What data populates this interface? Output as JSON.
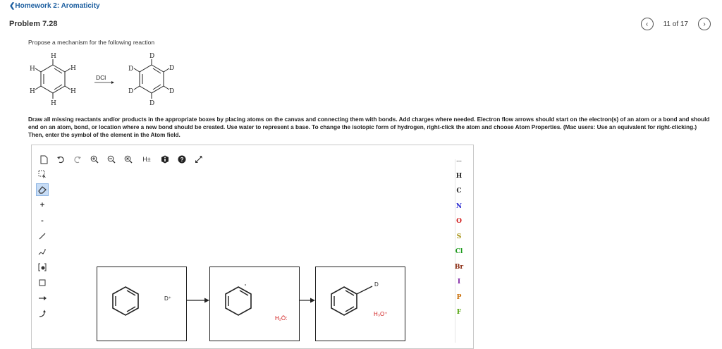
{
  "header": {
    "back_label": "❮Homework 2: Aromaticity",
    "problem_title": "Problem 7.28",
    "pager_text": "11 of 17",
    "prev_glyph": "‹",
    "next_glyph": "›"
  },
  "question": {
    "prompt": "Propose a mechanism for the following reaction",
    "reagent": "DCl",
    "instructions": "Draw all missing reactants and/or products in the appropriate boxes by placing atoms on the canvas and connecting them with bonds. Add charges where needed. Electron flow arrows should start on the electron(s) of an atom or a bond and should end on an atom, bond, or location where a new bond should be created. Use water to represent a base. To change the isotopic form of hydrogen, right-click the atom and choose Atom Properties. (Mac users: Use an equivalent for right-clicking.) Then, enter the symbol of the element in the Atom field."
  },
  "editor": {
    "toolbar_top": [
      "new-icon",
      "undo-icon",
      "redo-icon",
      "zoom-in-icon",
      "zoom-out-icon",
      "zoom-reset-icon",
      "explicit-h-icon",
      "info-icon",
      "help-icon",
      "fullscreen-icon"
    ],
    "explicit_h_label": "H±",
    "left_tools": [
      "select",
      "erase",
      "charge-plus",
      "charge-minus",
      "bond",
      "chain",
      "template",
      "shape",
      "arrow",
      "curved-arrow"
    ],
    "plus_label": "+",
    "minus_label": "-",
    "atoms": [
      {
        "symbol": "H",
        "color": "#222222"
      },
      {
        "symbol": "C",
        "color": "#222222"
      },
      {
        "symbol": "N",
        "color": "#2b2bd0"
      },
      {
        "symbol": "O",
        "color": "#d01818"
      },
      {
        "symbol": "S",
        "color": "#a08a00"
      },
      {
        "symbol": "Cl",
        "color": "#1a9a1a"
      },
      {
        "symbol": "Br",
        "color": "#8a2a10"
      },
      {
        "symbol": "I",
        "color": "#7a1aa0"
      },
      {
        "symbol": "P",
        "color": "#c86a00"
      },
      {
        "symbol": "F",
        "color": "#4aa000"
      }
    ],
    "boxes": {
      "box1_label": "D⁺",
      "box2_label": "H₂Ö:",
      "box3_label": "H₃O⁺",
      "box3_substituent": "D"
    },
    "reaction_labels": {
      "h_top": "H",
      "h_ul": "H",
      "h_ur": "H",
      "h_ll": "H",
      "h_lr": "H",
      "h_bot": "H",
      "d_top": "D",
      "d_ul": "D",
      "d_ur": "D",
      "d_ll": "D",
      "d_lr": "D",
      "d_bot": "D"
    }
  },
  "colors": {
    "link": "#1d5fa0",
    "water_red": "#d01818",
    "selected_tool": "#c7dcf5"
  }
}
